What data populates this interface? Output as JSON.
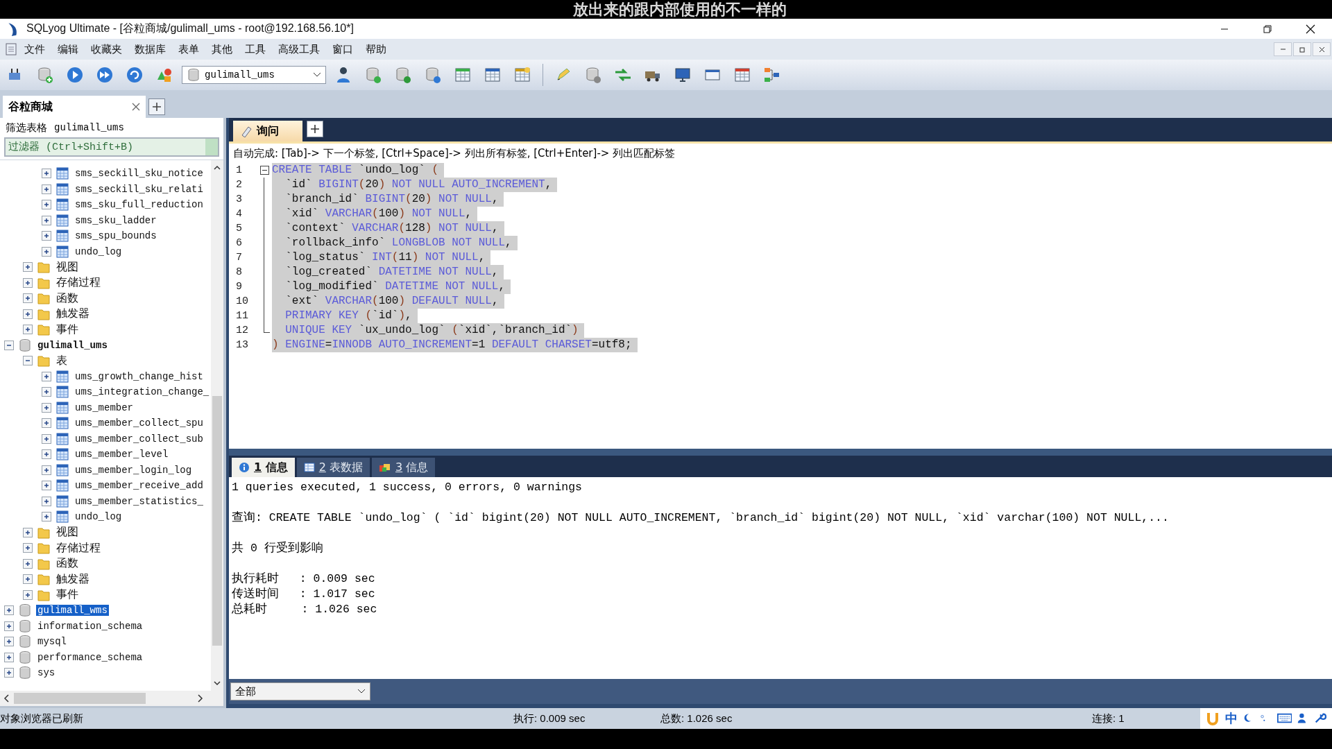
{
  "subtitle": "放出来的跟内部使用的不一样的",
  "window": {
    "title": "SQLyog Ultimate - [谷粒商城/gulimall_ums - root@192.168.56.10*]"
  },
  "menu": [
    "文件",
    "编辑",
    "收藏夹",
    "数据库",
    "表单",
    "其他",
    "工具",
    "高级工具",
    "窗口",
    "帮助"
  ],
  "toolbar": {
    "database": "gulimall_ums"
  },
  "connection_tabs": [
    {
      "label": "谷粒商城",
      "selected": true
    }
  ],
  "object_browser": {
    "title": "筛选表格",
    "database": "gulimall_ums",
    "filter_placeholder": "过滤器 (Ctrl+Shift+B)",
    "tree": [
      {
        "kind": "offscreen",
        "children": [
          {
            "kind": "offscreen",
            "children": [
              {
                "kind": "table",
                "label": "sms_seckill_sku_notice",
                "expanded": false,
                "selected": false
              },
              {
                "kind": "table",
                "label": "sms_seckill_sku_relati",
                "expanded": false,
                "selected": false
              },
              {
                "kind": "table",
                "label": "sms_sku_full_reduction",
                "expanded": false,
                "selected": false
              },
              {
                "kind": "table",
                "label": "sms_sku_ladder",
                "expanded": false,
                "selected": false
              },
              {
                "kind": "table",
                "label": "sms_spu_bounds",
                "expanded": false,
                "selected": false
              },
              {
                "kind": "table",
                "label": "undo_log",
                "expanded": false,
                "selected": false
              }
            ]
          },
          {
            "kind": "folder",
            "label": "视图",
            "expanded": false,
            "selected": false
          },
          {
            "kind": "folder",
            "label": "存储过程",
            "expanded": false,
            "selected": false
          },
          {
            "kind": "folder",
            "label": "函数",
            "expanded": false,
            "selected": false
          },
          {
            "kind": "folder",
            "label": "触发器",
            "expanded": false,
            "selected": false
          },
          {
            "kind": "folder",
            "label": "事件",
            "expanded": false,
            "selected": false
          }
        ]
      },
      {
        "kind": "database",
        "label": "gulimall_ums",
        "expanded": true,
        "selected": false,
        "children": [
          {
            "kind": "folder",
            "label": "表",
            "expanded": true,
            "selected": false,
            "children": [
              {
                "kind": "table",
                "label": "ums_growth_change_hist",
                "expanded": false,
                "selected": false
              },
              {
                "kind": "table",
                "label": "ums_integration_change_",
                "expanded": false,
                "selected": false
              },
              {
                "kind": "table",
                "label": "ums_member",
                "expanded": false,
                "selected": false
              },
              {
                "kind": "table",
                "label": "ums_member_collect_spu",
                "expanded": false,
                "selected": false
              },
              {
                "kind": "table",
                "label": "ums_member_collect_sub",
                "expanded": false,
                "selected": false
              },
              {
                "kind": "table",
                "label": "ums_member_level",
                "expanded": false,
                "selected": false
              },
              {
                "kind": "table",
                "label": "ums_member_login_log",
                "expanded": false,
                "selected": false
              },
              {
                "kind": "table",
                "label": "ums_member_receive_add",
                "expanded": false,
                "selected": false
              },
              {
                "kind": "table",
                "label": "ums_member_statistics_",
                "expanded": false,
                "selected": false
              },
              {
                "kind": "table",
                "label": "undo_log",
                "expanded": false,
                "selected": false
              }
            ]
          },
          {
            "kind": "folder",
            "label": "视图",
            "expanded": false,
            "selected": false
          },
          {
            "kind": "folder",
            "label": "存储过程",
            "expanded": false,
            "selected": false
          },
          {
            "kind": "folder",
            "label": "函数",
            "expanded": false,
            "selected": false
          },
          {
            "kind": "folder",
            "label": "触发器",
            "expanded": false,
            "selected": false
          },
          {
            "kind": "folder",
            "label": "事件",
            "expanded": false,
            "selected": false
          }
        ]
      },
      {
        "kind": "database",
        "label": "gulimall_wms",
        "expanded": false,
        "selected": true
      },
      {
        "kind": "database",
        "label": "information_schema",
        "expanded": false,
        "selected": false
      },
      {
        "kind": "database",
        "label": "mysql",
        "expanded": false,
        "selected": false
      },
      {
        "kind": "database",
        "label": "performance_schema",
        "expanded": false,
        "selected": false
      },
      {
        "kind": "database",
        "label": "sys",
        "expanded": false,
        "selected": false
      }
    ]
  },
  "query_tabs": [
    {
      "label": "询问",
      "selected": true
    }
  ],
  "editor": {
    "fold_expanded": true,
    "hint": "自动完成: [Tab]-> 下一个标签, [Ctrl+Space]-> 列出所有标签, [Ctrl+Enter]-> 列出匹配标签",
    "lines": [
      {
        "number": "1",
        "selected": true,
        "segments": [
          {
            "kind": "kw",
            "text": "CREATE TABLE"
          },
          {
            "kind": "text",
            "text": " `undo_log` "
          },
          {
            "kind": "paren",
            "text": "("
          }
        ]
      },
      {
        "number": "2",
        "selected": true,
        "segments": [
          {
            "kind": "text",
            "text": "  `id` "
          },
          {
            "kind": "kw",
            "text": "BIGINT"
          },
          {
            "kind": "paren",
            "text": "("
          },
          {
            "kind": "text",
            "text": "20"
          },
          {
            "kind": "paren",
            "text": ")"
          },
          {
            "kind": "kw",
            "text": " NOT NULL AUTO_INCREMENT"
          },
          {
            "kind": "text",
            "text": ","
          }
        ]
      },
      {
        "number": "3",
        "selected": true,
        "segments": [
          {
            "kind": "text",
            "text": "  `branch_id` "
          },
          {
            "kind": "kw",
            "text": "BIGINT"
          },
          {
            "kind": "paren",
            "text": "("
          },
          {
            "kind": "text",
            "text": "20"
          },
          {
            "kind": "paren",
            "text": ")"
          },
          {
            "kind": "kw",
            "text": " NOT NULL"
          },
          {
            "kind": "text",
            "text": ","
          }
        ]
      },
      {
        "number": "4",
        "selected": true,
        "segments": [
          {
            "kind": "text",
            "text": "  `xid` "
          },
          {
            "kind": "kw",
            "text": "VARCHAR"
          },
          {
            "kind": "paren",
            "text": "("
          },
          {
            "kind": "text",
            "text": "100"
          },
          {
            "kind": "paren",
            "text": ")"
          },
          {
            "kind": "kw",
            "text": " NOT NULL"
          },
          {
            "kind": "text",
            "text": ","
          }
        ]
      },
      {
        "number": "5",
        "selected": true,
        "segments": [
          {
            "kind": "text",
            "text": "  `context` "
          },
          {
            "kind": "kw",
            "text": "VARCHAR"
          },
          {
            "kind": "paren",
            "text": "("
          },
          {
            "kind": "text",
            "text": "128"
          },
          {
            "kind": "paren",
            "text": ")"
          },
          {
            "kind": "kw",
            "text": " NOT NULL"
          },
          {
            "kind": "text",
            "text": ","
          }
        ]
      },
      {
        "number": "6",
        "selected": true,
        "segments": [
          {
            "kind": "text",
            "text": "  `rollback_info` "
          },
          {
            "kind": "kw",
            "text": "LONGBLOB NOT NULL"
          },
          {
            "kind": "text",
            "text": ","
          }
        ]
      },
      {
        "number": "7",
        "selected": true,
        "segments": [
          {
            "kind": "text",
            "text": "  `log_status` "
          },
          {
            "kind": "kw",
            "text": "INT"
          },
          {
            "kind": "paren",
            "text": "("
          },
          {
            "kind": "text",
            "text": "11"
          },
          {
            "kind": "paren",
            "text": ")"
          },
          {
            "kind": "kw",
            "text": " NOT NULL"
          },
          {
            "kind": "text",
            "text": ","
          }
        ]
      },
      {
        "number": "8",
        "selected": true,
        "segments": [
          {
            "kind": "text",
            "text": "  `log_created` "
          },
          {
            "kind": "kw",
            "text": "DATETIME NOT NULL"
          },
          {
            "kind": "text",
            "text": ","
          }
        ]
      },
      {
        "number": "9",
        "selected": true,
        "segments": [
          {
            "kind": "text",
            "text": "  `log_modified` "
          },
          {
            "kind": "kw",
            "text": "DATETIME NOT NULL"
          },
          {
            "kind": "text",
            "text": ","
          }
        ]
      },
      {
        "number": "10",
        "selected": true,
        "segments": [
          {
            "kind": "text",
            "text": "  `ext` "
          },
          {
            "kind": "kw",
            "text": "VARCHAR"
          },
          {
            "kind": "paren",
            "text": "("
          },
          {
            "kind": "text",
            "text": "100"
          },
          {
            "kind": "paren",
            "text": ")"
          },
          {
            "kind": "kw",
            "text": " DEFAULT NULL"
          },
          {
            "kind": "text",
            "text": ","
          }
        ]
      },
      {
        "number": "11",
        "selected": true,
        "segments": [
          {
            "kind": "kw",
            "text": "  PRIMARY KEY "
          },
          {
            "kind": "paren",
            "text": "("
          },
          {
            "kind": "text",
            "text": "`id`"
          },
          {
            "kind": "paren",
            "text": ")"
          },
          {
            "kind": "text",
            "text": ","
          }
        ]
      },
      {
        "number": "12",
        "selected": true,
        "segments": [
          {
            "kind": "kw",
            "text": "  UNIQUE KEY "
          },
          {
            "kind": "text",
            "text": "`ux_undo_log` "
          },
          {
            "kind": "paren",
            "text": "("
          },
          {
            "kind": "text",
            "text": "`xid`,`branch_id`"
          },
          {
            "kind": "paren",
            "text": ")"
          }
        ]
      },
      {
        "number": "13",
        "selected": true,
        "segments": [
          {
            "kind": "paren",
            "text": ")"
          },
          {
            "kind": "kw",
            "text": " ENGINE"
          },
          {
            "kind": "text",
            "text": "="
          },
          {
            "kind": "kw",
            "text": "INNODB AUTO_INCREMENT"
          },
          {
            "kind": "text",
            "text": "=1 "
          },
          {
            "kind": "kw",
            "text": "DEFAULT CHARSET"
          },
          {
            "kind": "text",
            "text": "=utf8;"
          }
        ]
      }
    ]
  },
  "result_tabs": [
    {
      "kind": "info",
      "number": "1",
      "label": "信息",
      "selected": true
    },
    {
      "kind": "table",
      "number": "2",
      "label": "表数据",
      "selected": false
    },
    {
      "kind": "messages",
      "number": "3",
      "label": "信息",
      "selected": false
    }
  ],
  "result_paragraphs": [
    [
      "1 queries executed, 1 success, 0 errors, 0 warnings"
    ],
    [
      "查询: CREATE TABLE `undo_log` ( `id` bigint(20) NOT NULL AUTO_INCREMENT, `branch_id` bigint(20) NOT NULL, `xid` varchar(100) NOT NULL,..."
    ],
    [
      "共 0 行受到影响"
    ],
    [
      "执行耗时   : 0.009 sec",
      "传送时间   : 1.017 sec",
      "总耗时     : 1.026 sec"
    ]
  ],
  "result_filter": "全部",
  "status_bar": {
    "message": "对象浏览器已刷新",
    "execution": "执行: 0.009 sec",
    "total": "总数: 1.026 sec",
    "connections": "连接: 1",
    "ime_mode": "中"
  }
}
